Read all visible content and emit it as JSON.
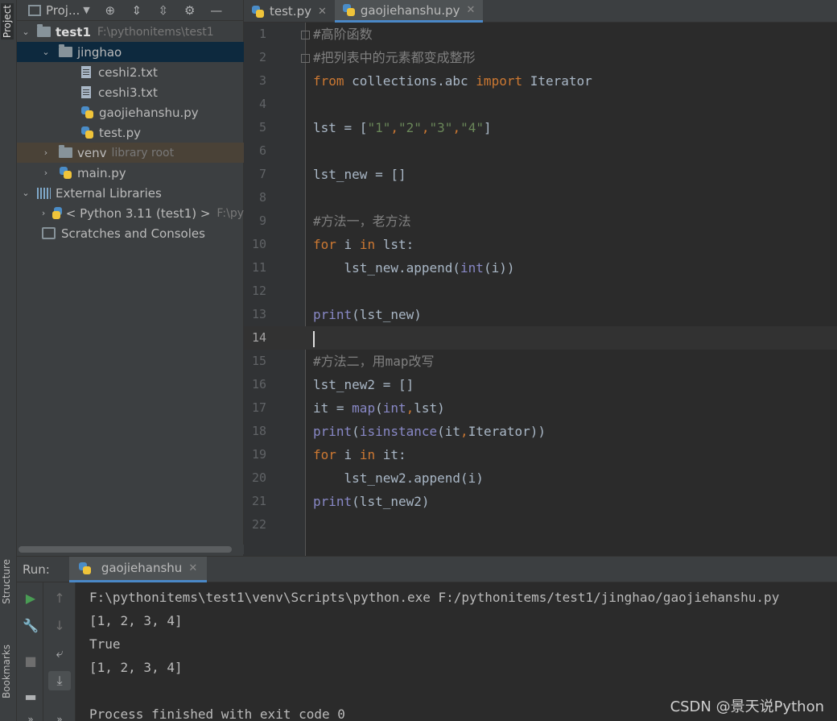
{
  "toolstrip": {
    "project": "Project",
    "structure": "Structure",
    "bookmarks": "Bookmarks"
  },
  "project_toolbar": {
    "label": "Proj..."
  },
  "tree": [
    {
      "name": "test1",
      "path": "F:\\pythonitems\\test1"
    },
    {
      "name": "jinghao"
    },
    {
      "name": "ceshi2.txt"
    },
    {
      "name": "ceshi3.txt"
    },
    {
      "name": "gaojiehanshu.py"
    },
    {
      "name": "test.py"
    },
    {
      "name": "venv",
      "path": "library root"
    },
    {
      "name": "main.py"
    },
    {
      "name": "External Libraries"
    },
    {
      "name": "< Python 3.11 (test1) >",
      "path": "F:\\py"
    },
    {
      "name": "Scratches and Consoles"
    }
  ],
  "tabs": [
    {
      "label": "test.py"
    },
    {
      "label": "gaojiehanshu.py"
    }
  ],
  "code_lines": [
    {
      "n": "1",
      "tokens": [
        {
          "t": "#高阶函数",
          "c": "cm"
        }
      ]
    },
    {
      "n": "2",
      "tokens": [
        {
          "t": "#把列表中的元素都变成整形",
          "c": "cm"
        }
      ]
    },
    {
      "n": "3",
      "tokens": [
        {
          "t": "from",
          "c": "kw"
        },
        {
          "t": " collections.abc ",
          "c": ""
        },
        {
          "t": "import",
          "c": "kw"
        },
        {
          "t": " Iterator",
          "c": ""
        }
      ]
    },
    {
      "n": "4",
      "tokens": []
    },
    {
      "n": "5",
      "tokens": [
        {
          "t": "lst = [",
          "c": ""
        },
        {
          "t": "\"1\"",
          "c": "str"
        },
        {
          "t": ",",
          "c": "kw"
        },
        {
          "t": "\"2\"",
          "c": "str"
        },
        {
          "t": ",",
          "c": "kw"
        },
        {
          "t": "\"3\"",
          "c": "str"
        },
        {
          "t": ",",
          "c": "kw"
        },
        {
          "t": "\"4\"",
          "c": "str"
        },
        {
          "t": "]",
          "c": ""
        }
      ]
    },
    {
      "n": "6",
      "tokens": []
    },
    {
      "n": "7",
      "tokens": [
        {
          "t": "lst_new = []",
          "c": ""
        }
      ]
    },
    {
      "n": "8",
      "tokens": []
    },
    {
      "n": "9",
      "tokens": [
        {
          "t": "#方法一，老方法",
          "c": "cm"
        }
      ]
    },
    {
      "n": "10",
      "tokens": [
        {
          "t": "for",
          "c": "kw"
        },
        {
          "t": " i ",
          "c": ""
        },
        {
          "t": "in",
          "c": "kw"
        },
        {
          "t": " lst:",
          "c": ""
        }
      ]
    },
    {
      "n": "11",
      "tokens": [
        {
          "t": "    lst_new.append(",
          "c": ""
        },
        {
          "t": "int",
          "c": "bi"
        },
        {
          "t": "(i))",
          "c": ""
        }
      ]
    },
    {
      "n": "12",
      "tokens": []
    },
    {
      "n": "13",
      "tokens": [
        {
          "t": "print",
          "c": "bi"
        },
        {
          "t": "(lst_new)",
          "c": ""
        }
      ]
    },
    {
      "n": "14",
      "tokens": []
    },
    {
      "n": "15",
      "tokens": [
        {
          "t": "#方法二，用map改写",
          "c": "cm"
        }
      ]
    },
    {
      "n": "16",
      "tokens": [
        {
          "t": "lst_new2 = []",
          "c": ""
        }
      ]
    },
    {
      "n": "17",
      "tokens": [
        {
          "t": "it = ",
          "c": ""
        },
        {
          "t": "map",
          "c": "bi"
        },
        {
          "t": "(",
          "c": ""
        },
        {
          "t": "int",
          "c": "bi"
        },
        {
          "t": ",",
          "c": "kw"
        },
        {
          "t": "lst)",
          "c": ""
        }
      ]
    },
    {
      "n": "18",
      "tokens": [
        {
          "t": "print",
          "c": "bi"
        },
        {
          "t": "(",
          "c": ""
        },
        {
          "t": "isinstance",
          "c": "bi"
        },
        {
          "t": "(it",
          "c": ""
        },
        {
          "t": ",",
          "c": "kw"
        },
        {
          "t": "Iterator))",
          "c": ""
        }
      ]
    },
    {
      "n": "19",
      "tokens": [
        {
          "t": "for",
          "c": "kw"
        },
        {
          "t": " i ",
          "c": ""
        },
        {
          "t": "in",
          "c": "kw"
        },
        {
          "t": " it:",
          "c": ""
        }
      ]
    },
    {
      "n": "20",
      "tokens": [
        {
          "t": "    lst_new2.append(i)",
          "c": ""
        }
      ]
    },
    {
      "n": "21",
      "tokens": [
        {
          "t": "print",
          "c": "bi"
        },
        {
          "t": "(lst_new2)",
          "c": ""
        }
      ]
    },
    {
      "n": "22",
      "tokens": []
    }
  ],
  "current_line": "14",
  "run": {
    "label": "Run:",
    "tab": "gaojiehanshu",
    "console": [
      "F:\\pythonitems\\test1\\venv\\Scripts\\python.exe F:/pythonitems/test1/jinghao/gaojiehanshu.py",
      "[1, 2, 3, 4]",
      "True",
      "[1, 2, 3, 4]",
      "",
      "Process finished with exit code 0"
    ]
  },
  "watermark": "CSDN @景天说Python"
}
